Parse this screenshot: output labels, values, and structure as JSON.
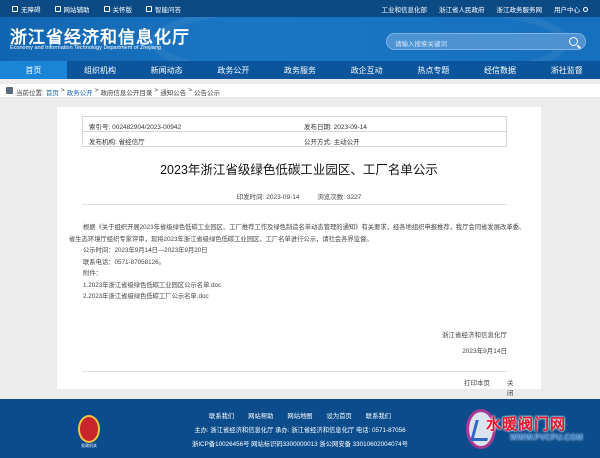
{
  "topbar": {
    "left": [
      "无障碍",
      "网站辅助",
      "关怀版",
      "智能问答"
    ],
    "right": [
      "工业和信息化部",
      "浙江省人民政府",
      "浙江政务服务网",
      "用户中心"
    ]
  },
  "header": {
    "title_cn": "浙江省经济和信息化厅",
    "title_en": "Economy and Information Technology Department of Zhejiang",
    "search_placeholder": "请输入搜索关键词"
  },
  "nav": [
    "首页",
    "组织机构",
    "新闻动态",
    "政务公开",
    "政务服务",
    "政企互动",
    "热点专题",
    "经信数据",
    "浙社监督"
  ],
  "breadcrumb": {
    "prefix": "当前位置:",
    "items": [
      "首页",
      "政务公开",
      "政府信息公开目录",
      "通知公告",
      "公告公示"
    ],
    "sep": ">"
  },
  "meta": {
    "index_no": "索引号: 002482904/2023-00942",
    "issue_date": "发布日期: 2023-09-14",
    "issuer": "发布机构: 省经信厅",
    "open_type": "公开方式: 主动公开"
  },
  "article": {
    "title": "2023年浙江省级绿色低碳工业园区、工厂名单公示",
    "print_date": "印发时间: 2023-09-14",
    "views": "浏览次数: 3227",
    "para1": "根据《关于组织开展2023年省级绿色低碳工业园区、工厂推荐工作及绿色制造名单动态管理的通知》有关要求，经各地组织申报推荐，我厅会同省发展改革委、省生态环境厅组织专家评审，现将2023年浙江省级绿色低碳工业园区、工厂名单进行公示，请社会各界监督。",
    "period": "公示时间：2023年9月14日—2023年9月20日",
    "phone": "联系电话：0571-87058126。",
    "attach_label": "附件：",
    "attach1": "1.2023年浙江省级绿色低碳工业园区公示名单.doc",
    "attach2": "2.2023年浙江省级绿色低碳工厂公示名单.doc",
    "sign_org": "浙江省经济和信息化厅",
    "sign_date": "2023年9月14日"
  },
  "actions": {
    "print": "打印本页",
    "close": "关闭窗口"
  },
  "footer": {
    "links": [
      "联系我们",
      "网站帮助",
      "网站地图",
      "设为首页",
      "联系我们"
    ],
    "line2": "主办: 浙江省经济和信息化厅   承办: 浙江省经济和信息化厅   电话: 0571-87056",
    "line3": "浙ICP备10026456号   网站标识码3300000013   浙公网安备 33010602004074号",
    "emblem_text": "党政机关"
  },
  "watermark": {
    "line1": "水暖阀门网",
    "line2": "WWW.PVCPU.COM"
  }
}
